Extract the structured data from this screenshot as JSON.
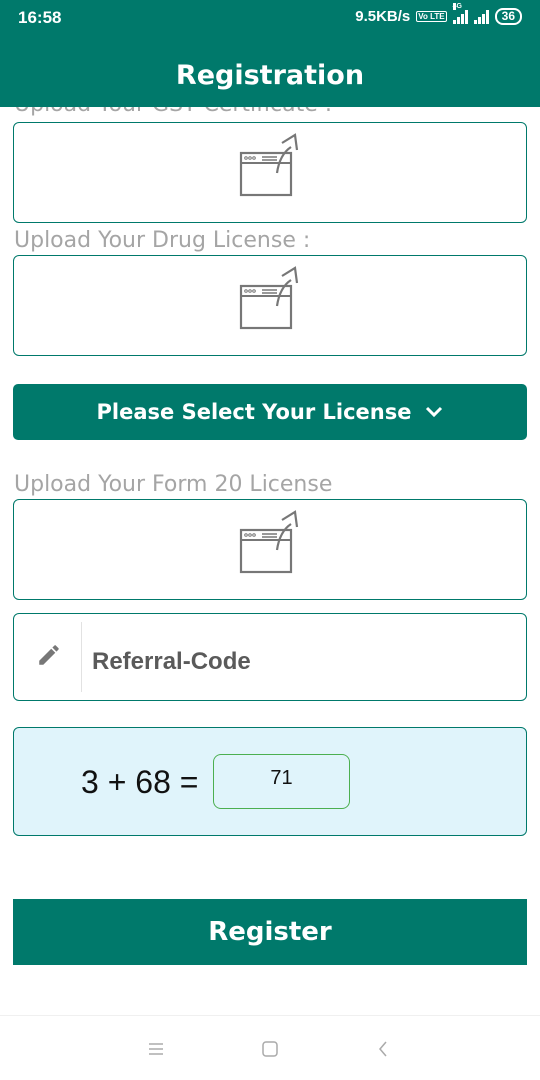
{
  "status_bar": {
    "time": "16:58",
    "speed": "9.5KB/s",
    "volte": "Vo LTE",
    "network": "4G",
    "battery": "36"
  },
  "header": {
    "title": "Registration"
  },
  "form": {
    "gst_label": "Upload Your GST Certificate :",
    "drug_label": "Upload Your Drug License :",
    "select_license_label": "Please Select Your License",
    "form20_label": "Upload Your Form 20 License",
    "referral_value": "Referral-Code",
    "captcha_question": "3 + 68 =",
    "captcha_answer": "71",
    "register_label": "Register"
  },
  "icons": {
    "upload": "upload-icon",
    "chevron": "chevron-down-icon",
    "pencil": "pencil-icon",
    "nav_menu": "menu-icon",
    "nav_home": "home-icon",
    "nav_back": "back-icon"
  },
  "colors": {
    "primary": "#00796b",
    "captcha_bg": "#e0f4fb",
    "captcha_border": "#4caf50",
    "label": "#a5a5a5"
  }
}
